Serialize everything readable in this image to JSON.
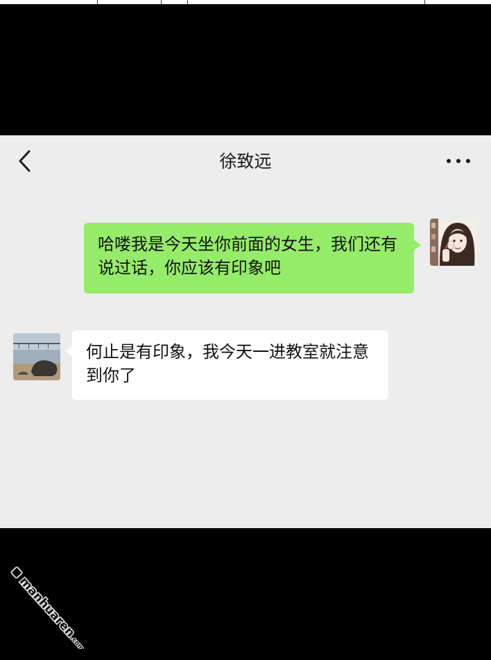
{
  "chat": {
    "title": "徐致远",
    "back_icon": "chevron-left-icon",
    "more_icon": "more-dots-icon"
  },
  "messages": [
    {
      "direction": "sent",
      "text": "哈喽我是今天坐你前面的女生，我们还有说过话，你应该有印象吧",
      "bubble_color": "#95ec69"
    },
    {
      "direction": "received",
      "text": "何止是有印象，我今天一进教室就注意到你了",
      "bubble_color": "#ffffff"
    }
  ],
  "watermark": {
    "text": "manhuaren.com"
  },
  "colors": {
    "chat_background": "#ededed",
    "page_background": "#000000"
  }
}
